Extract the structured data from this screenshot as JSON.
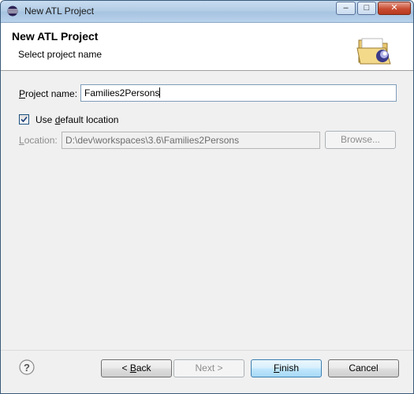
{
  "window": {
    "title": "New ATL Project",
    "controls": {
      "minimize": "–",
      "maximize": "□",
      "close": "✕"
    }
  },
  "header": {
    "title": "New ATL Project",
    "description": "Select project name",
    "banner_icon": "open-folder-wizard-icon"
  },
  "form": {
    "project_name": {
      "label_prefix": "P",
      "label_rest": "roject name:",
      "value": "Families2Persons"
    },
    "use_default_location": {
      "label_prefix": "Use ",
      "label_mnemonic": "d",
      "label_rest": "efault location",
      "checked": true
    },
    "location": {
      "label_mnemonic": "L",
      "label_rest": "ocation:",
      "value": "D:\\dev\\workspaces\\3.6\\Families2Persons",
      "enabled": false
    },
    "browse_button": {
      "label": "Browse...",
      "enabled": false
    }
  },
  "footer": {
    "help_icon": "help-icon",
    "back": {
      "prefix": "< ",
      "mnemonic": "B",
      "rest": "ack"
    },
    "next": {
      "label": "Next >",
      "enabled": false
    },
    "finish": {
      "mnemonic": "F",
      "rest": "inish"
    },
    "cancel": {
      "label": "Cancel"
    }
  },
  "colors": {
    "accent": "#3c7fb1",
    "close_button": "#c84b31"
  }
}
